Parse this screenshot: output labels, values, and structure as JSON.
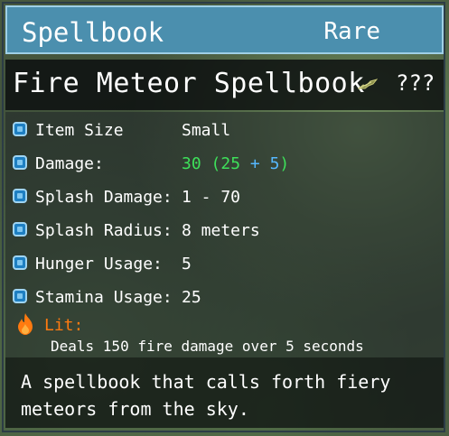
{
  "header": {
    "title": "Spellbook",
    "rarity": "Rare"
  },
  "item": {
    "name": "Fire Meteor Spellbook",
    "unknown_icon": "leaf-icon",
    "unknown_text": "???"
  },
  "stats": [
    {
      "label": "Item Size",
      "value": "Small"
    },
    {
      "label": "Damage:",
      "value_total": "30",
      "value_open": "(25 ",
      "value_bonus": "+ 5",
      "value_close": ")"
    },
    {
      "label": "Splash Damage:",
      "value": "1 - 70"
    },
    {
      "label": "Splash Radius:",
      "value": "8 meters"
    },
    {
      "label": "Hunger Usage:",
      "value": "5"
    },
    {
      "label": "Stamina Usage:",
      "value": "25"
    }
  ],
  "effect": {
    "icon": "flame-icon",
    "label": "Lit:",
    "description": "Deals 150 fire damage over 5 seconds"
  },
  "description": "A spellbook that calls forth fiery meteors from the sky.",
  "colors": {
    "header_bg": "#4b8fae",
    "header_border": "#9fd0e6",
    "bonus_green": "#3ee05a",
    "bonus_blue": "#56b8ff",
    "lit_orange": "#ff7a10"
  }
}
